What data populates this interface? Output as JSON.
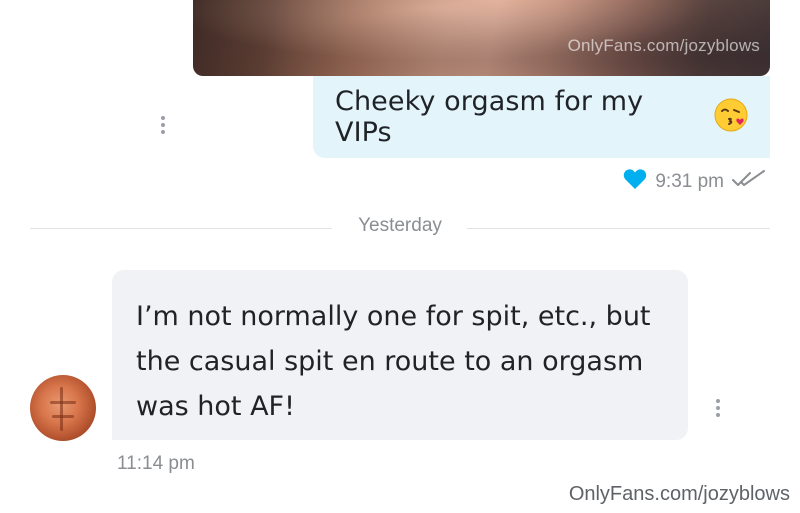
{
  "colors": {
    "outgoing_bubble": "#e3f4fb",
    "incoming_bubble": "#f0f2f5",
    "heart": "#00aff0",
    "meta_text": "#8a8d91"
  },
  "outgoing": {
    "media_watermark": "OnlyFans.com/jozyblows",
    "text": "Cheeky orgasm for my VIPs",
    "emoji_icon": "face-blowing-kiss-emoji",
    "time": "9:31 pm",
    "liked": true,
    "read_icon": "double-check-icon"
  },
  "separator": {
    "label": "Yesterday"
  },
  "incoming": {
    "text": "I’m not normally one for spit, etc., but the casual spit en route to an orgasm was hot AF!",
    "time": "11:14 pm"
  },
  "watermark": "OnlyFans.com/jozyblows"
}
